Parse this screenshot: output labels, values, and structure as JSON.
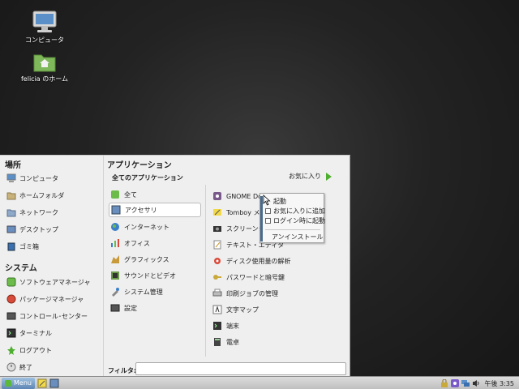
{
  "desktop": {
    "icons": [
      {
        "label": "コンピュータ",
        "icon": "computer-icon"
      },
      {
        "label": "felicia のホーム",
        "icon": "home-folder-icon"
      }
    ]
  },
  "menu": {
    "places_title": "場所",
    "places": [
      {
        "label": "コンピュータ",
        "icon": "computer-icon"
      },
      {
        "label": "ホームフォルダ",
        "icon": "home-folder-icon"
      },
      {
        "label": "ネットワーク",
        "icon": "network-icon"
      },
      {
        "label": "デスクトップ",
        "icon": "desktop-icon"
      },
      {
        "label": "ゴミ箱",
        "icon": "trash-icon"
      }
    ],
    "system_title": "システム",
    "system": [
      {
        "label": "ソフトウェアマネージャ",
        "icon": "software-manager-icon"
      },
      {
        "label": "パッケージマネージャ",
        "icon": "package-manager-icon"
      },
      {
        "label": "コントロール･センター",
        "icon": "control-center-icon"
      },
      {
        "label": "ターミナル",
        "icon": "terminal-icon"
      },
      {
        "label": "ログアウト",
        "icon": "logout-icon"
      },
      {
        "label": "終了",
        "icon": "power-icon"
      }
    ],
    "apps_title": "アプリケーション",
    "all_apps_label": "全てのアプリケーション",
    "favorites_label": "お気に入り",
    "categories": [
      {
        "label": "全て",
        "icon": "all-icon"
      },
      {
        "label": "アクセサリ",
        "icon": "accessories-icon",
        "selected": true
      },
      {
        "label": "インターネット",
        "icon": "internet-icon"
      },
      {
        "label": "オフィス",
        "icon": "office-icon"
      },
      {
        "label": "グラフィックス",
        "icon": "graphics-icon"
      },
      {
        "label": "サウンドとビデオ",
        "icon": "sound-video-icon"
      },
      {
        "label": "システム管理",
        "icon": "system-admin-icon"
      },
      {
        "label": "設定",
        "icon": "settings-icon"
      }
    ],
    "apps": [
      {
        "label": "GNOME Do",
        "icon": "gnome-do-icon"
      },
      {
        "label": "Tomboy メモ",
        "icon": "tomboy-icon"
      },
      {
        "label": "スクリーンショット",
        "icon": "screenshot-icon"
      },
      {
        "label": "テキスト・エディタ",
        "icon": "text-editor-icon"
      },
      {
        "label": "ディスク使用量の解析",
        "icon": "disk-usage-icon"
      },
      {
        "label": "パスワードと暗号鍵",
        "icon": "passwords-icon"
      },
      {
        "label": "印刷ジョブの管理",
        "icon": "print-icon"
      },
      {
        "label": "文字マップ",
        "icon": "charmap-icon"
      },
      {
        "label": "端末",
        "icon": "terminal-icon"
      },
      {
        "label": "電卓",
        "icon": "calculator-icon"
      }
    ],
    "filter_label": "フィルタ:",
    "filter_value": ""
  },
  "context_menu": {
    "launch": "起動",
    "add_favorites": "お気に入りに追加",
    "launch_on_login": "ログイン時に起動",
    "uninstall": "アンインストール"
  },
  "taskbar": {
    "menu_label": "Menu",
    "clock": "午後 3:35"
  }
}
